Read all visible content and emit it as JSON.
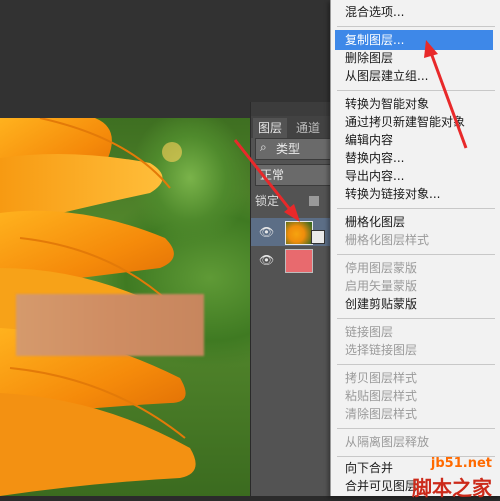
{
  "layers_panel": {
    "tab_layers": "图层",
    "tab_channels": "通道",
    "filter_kind": "类型",
    "blend_mode": "正常",
    "lock_label": "锁定"
  },
  "context_menu": {
    "items": [
      {
        "label": "混合选项...",
        "enabled": true
      },
      {
        "label": "复制图层...",
        "enabled": true,
        "highlighted": true
      },
      {
        "label": "删除图层",
        "enabled": true
      },
      {
        "label": "从图层建立组...",
        "enabled": true
      },
      {
        "label": "转换为智能对象",
        "enabled": true
      },
      {
        "label": "通过拷贝新建智能对象",
        "enabled": true
      },
      {
        "label": "编辑内容",
        "enabled": true
      },
      {
        "label": "替换内容...",
        "enabled": true
      },
      {
        "label": "导出内容...",
        "enabled": true
      },
      {
        "label": "转换为链接对象...",
        "enabled": true
      },
      {
        "label": "栅格化图层",
        "enabled": true
      },
      {
        "label": "栅格化图层样式",
        "enabled": false
      },
      {
        "label": "停用图层蒙版",
        "enabled": false
      },
      {
        "label": "启用矢量蒙版",
        "enabled": false
      },
      {
        "label": "创建剪贴蒙版",
        "enabled": true
      },
      {
        "label": "链接图层",
        "enabled": false
      },
      {
        "label": "选择链接图层",
        "enabled": false
      },
      {
        "label": "拷贝图层样式",
        "enabled": false
      },
      {
        "label": "粘贴图层样式",
        "enabled": false
      },
      {
        "label": "清除图层样式",
        "enabled": false
      },
      {
        "label": "从隔离图层释放",
        "enabled": false
      },
      {
        "label": "向下合并",
        "enabled": true
      },
      {
        "label": "合并可见图层",
        "enabled": true
      }
    ]
  },
  "watermark": {
    "site": "jb51.net",
    "name": "脚本之家"
  },
  "colors": {
    "highlight": "#3e88e8",
    "arrow": "#e8292a",
    "selected_layer": "#5c6e86"
  }
}
